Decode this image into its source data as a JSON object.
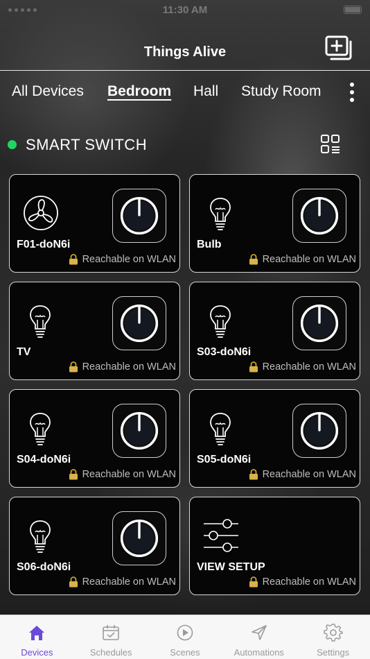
{
  "status_bar": {
    "time": "11:30 AM"
  },
  "header": {
    "title": "Things Alive",
    "add_icon": "add-device-icon"
  },
  "tabs": [
    {
      "label": "All Devices",
      "active": false
    },
    {
      "label": "Bedroom",
      "active": true
    },
    {
      "label": "Hall",
      "active": false
    },
    {
      "label": "Study Room",
      "active": false
    }
  ],
  "section": {
    "title": "SMART SWITCH",
    "status_color": "#1ed760",
    "view_icon": "grid-list-toggle-icon"
  },
  "devices": [
    {
      "name": "F01-doN6i",
      "icon": "fan-icon",
      "status": "Reachable on WLAN"
    },
    {
      "name": "Bulb",
      "icon": "bulb-icon",
      "status": "Reachable on WLAN"
    },
    {
      "name": "TV",
      "icon": "bulb-icon",
      "status": "Reachable on WLAN"
    },
    {
      "name": "S03-doN6i",
      "icon": "bulb-icon",
      "status": "Reachable on WLAN"
    },
    {
      "name": "S04-doN6i",
      "icon": "bulb-icon",
      "status": "Reachable on WLAN"
    },
    {
      "name": "S05-doN6i",
      "icon": "bulb-icon",
      "status": "Reachable on WLAN"
    },
    {
      "name": "S06-doN6i",
      "icon": "bulb-icon",
      "status": "Reachable on WLAN"
    },
    {
      "name": "VIEW SETUP",
      "icon": "sliders-icon",
      "status": "Reachable on WLAN"
    }
  ],
  "tabbar": [
    {
      "label": "Devices",
      "icon": "home-icon",
      "active": true
    },
    {
      "label": "Schedules",
      "icon": "calendar-check-icon",
      "active": false
    },
    {
      "label": "Scenes",
      "icon": "play-circle-icon",
      "active": false
    },
    {
      "label": "Automations",
      "icon": "send-icon",
      "active": false
    },
    {
      "label": "Settings",
      "icon": "gear-icon",
      "active": false
    }
  ],
  "colors": {
    "accent": "#6c4ad8",
    "online": "#1ed760"
  }
}
